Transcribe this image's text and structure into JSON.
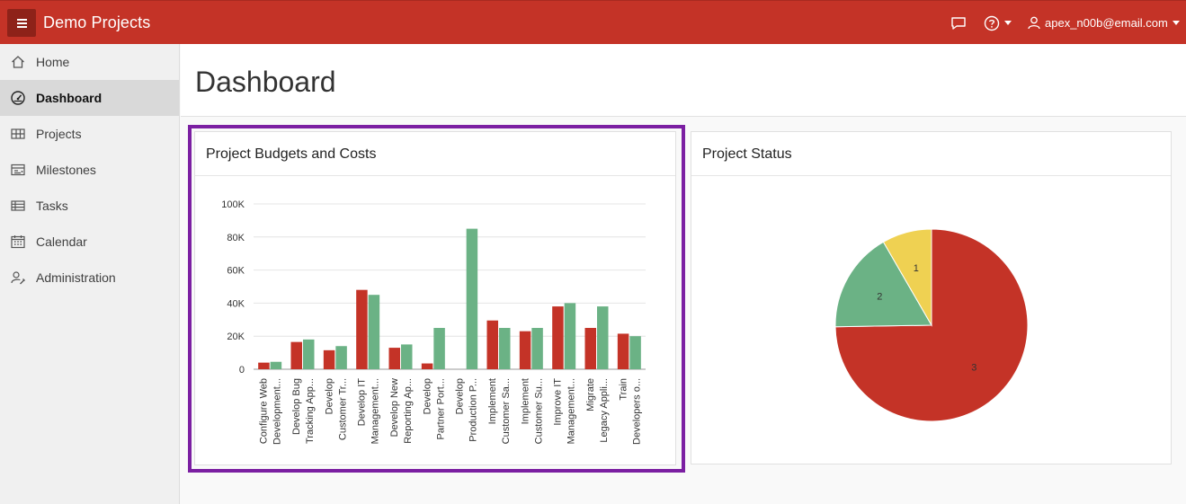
{
  "app": {
    "title": "Demo Projects"
  },
  "user": {
    "name": "apex_n00b@email.com"
  },
  "sidebar": {
    "items": [
      {
        "label": "Home",
        "icon": "home-icon"
      },
      {
        "label": "Dashboard",
        "icon": "dashboard-gauge-icon",
        "active": true
      },
      {
        "label": "Projects",
        "icon": "projects-grid-icon"
      },
      {
        "label": "Milestones",
        "icon": "milestones-icon"
      },
      {
        "label": "Tasks",
        "icon": "tasks-table-icon"
      },
      {
        "label": "Calendar",
        "icon": "calendar-icon"
      },
      {
        "label": "Administration",
        "icon": "user-wrench-icon"
      }
    ]
  },
  "page": {
    "title": "Dashboard"
  },
  "regions": {
    "budgets": {
      "title": "Project Budgets and Costs"
    },
    "status": {
      "title": "Project Status"
    }
  },
  "colors": {
    "header": "#c43327",
    "budget": "#c43327",
    "cost": "#6bb285",
    "yellow": "#efd152",
    "highlight": "#7b1fa2"
  },
  "chart_data": [
    {
      "type": "bar",
      "title": "Project Budgets and Costs",
      "categories": [
        [
          "Configure Web",
          "Development..."
        ],
        [
          "Develop Bug",
          "Tracking App..."
        ],
        [
          "Develop",
          "Customer Tr..."
        ],
        [
          "Develop IT",
          "Management..."
        ],
        [
          "Develop New",
          "Reporting Ap..."
        ],
        [
          "Develop",
          "Partner Port..."
        ],
        [
          "Develop",
          "Production P..."
        ],
        [
          "Implement",
          "Customer Sa..."
        ],
        [
          "Implement",
          "Customer Su..."
        ],
        [
          "Improve IT",
          "Management..."
        ],
        [
          "Migrate",
          "Legacy Appli..."
        ],
        [
          "Train",
          "Developers o..."
        ]
      ],
      "series": [
        {
          "color": "#c43327",
          "values": [
            4000,
            16500,
            11500,
            48000,
            13000,
            3500,
            0,
            29500,
            23000,
            38000,
            25000,
            21500
          ]
        },
        {
          "color": "#6bb285",
          "values": [
            4500,
            18000,
            14000,
            45000,
            15000,
            25000,
            85000,
            25000,
            25000,
            40000,
            38000,
            20000
          ]
        }
      ],
      "ylim": [
        0,
        100000
      ],
      "yticks": [
        "0",
        "20K",
        "40K",
        "60K",
        "80K",
        "100K"
      ],
      "ytick_values": [
        0,
        20000,
        40000,
        60000,
        80000,
        100000
      ],
      "grid": true
    },
    {
      "type": "pie",
      "title": "Project Status",
      "slices": [
        {
          "label": "3",
          "value": 3,
          "color": "#c43327"
        },
        {
          "label": "2",
          "value": 2,
          "color": "#6bb285"
        },
        {
          "label": "1",
          "value": 1,
          "color": "#efd152"
        }
      ],
      "slice_shares": [
        0.7474,
        0.1692,
        0.0834
      ]
    }
  ]
}
